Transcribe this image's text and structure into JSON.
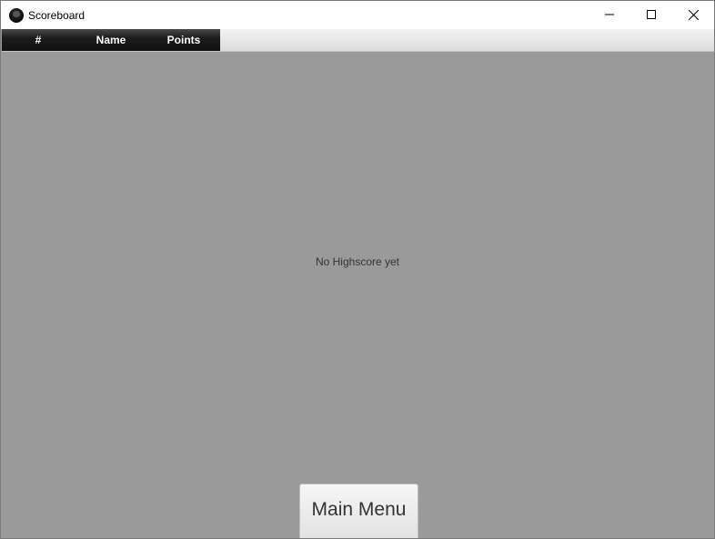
{
  "window": {
    "title": "Scoreboard",
    "icon": "app-logo-icon",
    "controls": [
      "minimize-icon",
      "maximize-icon",
      "close-icon"
    ]
  },
  "table": {
    "columns": [
      {
        "label": "#"
      },
      {
        "label": "Name"
      },
      {
        "label": "Points"
      }
    ],
    "rows": [],
    "placeholder": "No Highscore yet"
  },
  "actions": {
    "main_menu_label": "Main Menu"
  },
  "colors": {
    "background": "#9a9a9a",
    "header_dark": "#1c1c1c",
    "header_text": "#ffffff",
    "placeholder_text": "#333333"
  }
}
